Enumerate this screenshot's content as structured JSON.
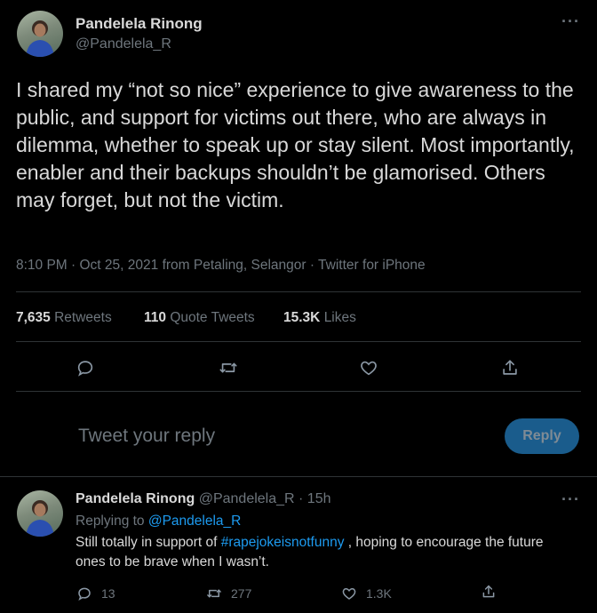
{
  "main_tweet": {
    "author_name": "Pandelela Rinong",
    "author_handle": "@Pandelela_R",
    "more_label": "···",
    "text": "I shared my “not so nice” experience to give awareness to the public, and support for victims out there, who are always in dilemma, whether to speak up or stay silent. Most importantly, enabler and their backups shouldn’t be glamorised. Others may forget, but not the victim.",
    "time": "8:10 PM · Oct 25, 2021",
    "location": " from Petaling, Selangor",
    "source": " · Twitter for iPhone",
    "stats": {
      "retweets_count": "7,635",
      "retweets_label": "Retweets",
      "quotes_count": "110",
      "quotes_label": "Quote Tweets",
      "likes_count": "15.3K",
      "likes_label": "Likes"
    },
    "actions": [
      "reply-icon",
      "retweet-icon",
      "like-icon",
      "share-icon"
    ]
  },
  "reply_box": {
    "placeholder": "Tweet your reply",
    "button_label": "Reply"
  },
  "reply_tweet": {
    "author_name": "Pandelela Rinong",
    "author_handle": "@Pandelela_R",
    "time": "15h",
    "more_label": "···",
    "replying_to_label": "Replying to ",
    "replying_to_handle": "@Pandelela_R",
    "text_before": "Still totally in support of ",
    "hashtag": "#rapejokeisnotfunny",
    "text_after": " , hoping to encourage the future ones to be brave when I wasn’t.",
    "reply_count": "13",
    "retweet_count": "277",
    "like_count": "1.3K"
  },
  "colors": {
    "background": "#000000",
    "text": "#d9d9d9",
    "muted": "#6e767d",
    "link": "#1d9bf0",
    "reply_button": "#1a5c8c"
  }
}
